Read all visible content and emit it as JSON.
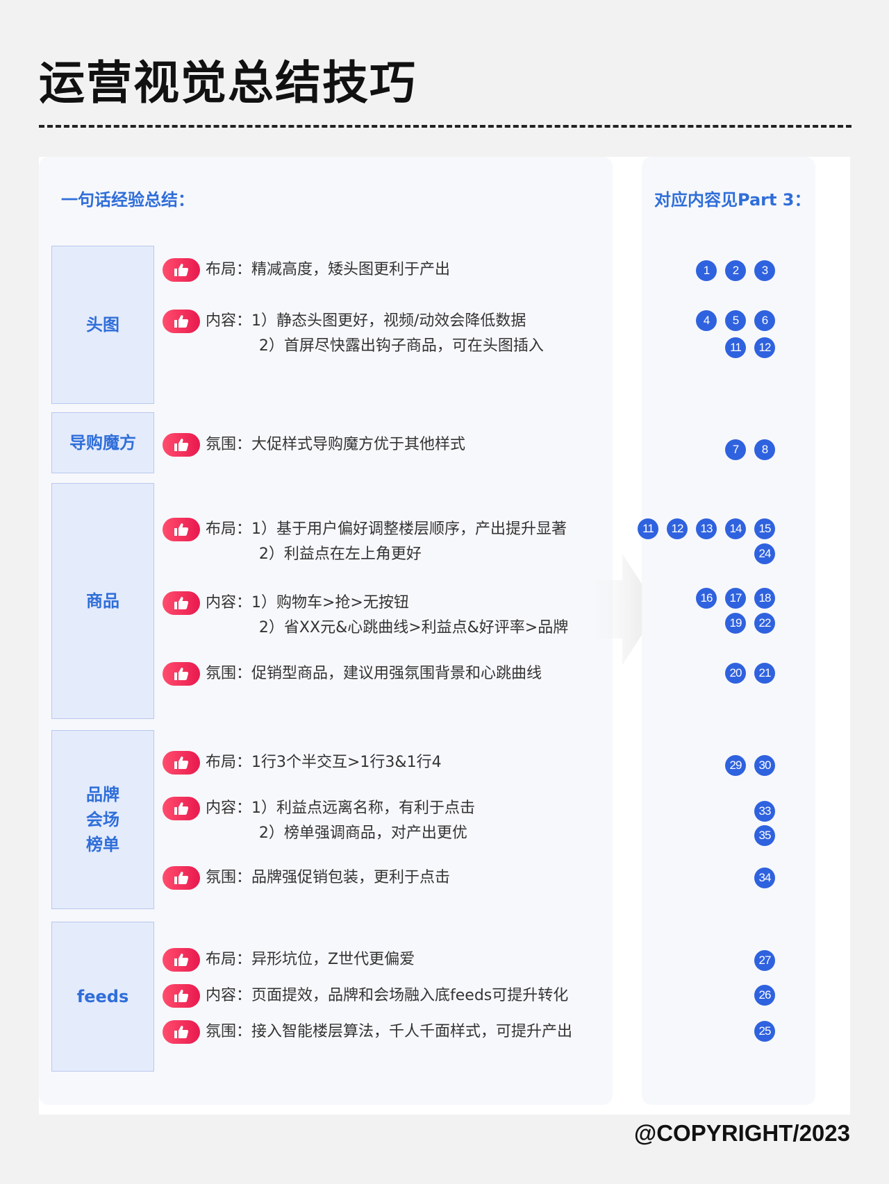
{
  "title": "运营视觉总结技巧",
  "left_heading": "一句话经验总结：",
  "right_heading": "对应内容见Part 3：",
  "categories": [
    {
      "label": "头图"
    },
    {
      "label": "导购魔方"
    },
    {
      "label": "商品"
    },
    {
      "label": "品牌\n会场\n榜单"
    },
    {
      "label": "feeds"
    }
  ],
  "tips": [
    "布局：精减高度，矮头图更利于产出",
    "内容：1）静态头图更好，视频/动效会降低数据\n           2）首屏尽快露出钩子商品，可在头图插入",
    "氛围：大促样式导购魔方优于其他样式",
    "布局：1）基于用户偏好调整楼层顺序，产出提升显著\n           2）利益点在左上角更好",
    "内容：1）购物车>抢>无按钮\n           2）省XX元&心跳曲线>利益点&好评率>品牌",
    "氛围：促销型商品，建议用强氛围背景和心跳曲线",
    "布局：1行3个半交互>1行3&1行4",
    "内容：1）利益点远离名称，有利于点击\n           2）榜单强调商品，对产出更优",
    "氛围：品牌强促销包装，更利于点击",
    "布局：异形坑位，Z世代更偏爱",
    "内容：页面提效，品牌和会场融入底feeds可提升转化",
    "氛围：接入智能楼层算法，千人千面样式，可提升产出"
  ],
  "refs": [
    [
      "1",
      "2",
      "3"
    ],
    [
      "4",
      "5",
      "6"
    ],
    [
      "11",
      "12"
    ],
    [
      "7",
      "8"
    ],
    [
      "11",
      "12",
      "13",
      "14",
      "15"
    ],
    [
      "24"
    ],
    [
      "16",
      "17",
      "18"
    ],
    [
      "19",
      "22"
    ],
    [
      "20",
      "21"
    ],
    [
      "29",
      "30"
    ],
    [
      "33"
    ],
    [
      "35"
    ],
    [
      "34"
    ],
    [
      "27"
    ],
    [
      "26"
    ],
    [
      "25"
    ]
  ],
  "copyright": "@COPYRIGHT/2023",
  "colors": {
    "accent": "#2f6ed9",
    "badge": "#e8194e",
    "number": "#2f62de"
  },
  "icons": {
    "tip": "thumbs-up-icon",
    "arrow": "right-arrow-icon"
  }
}
